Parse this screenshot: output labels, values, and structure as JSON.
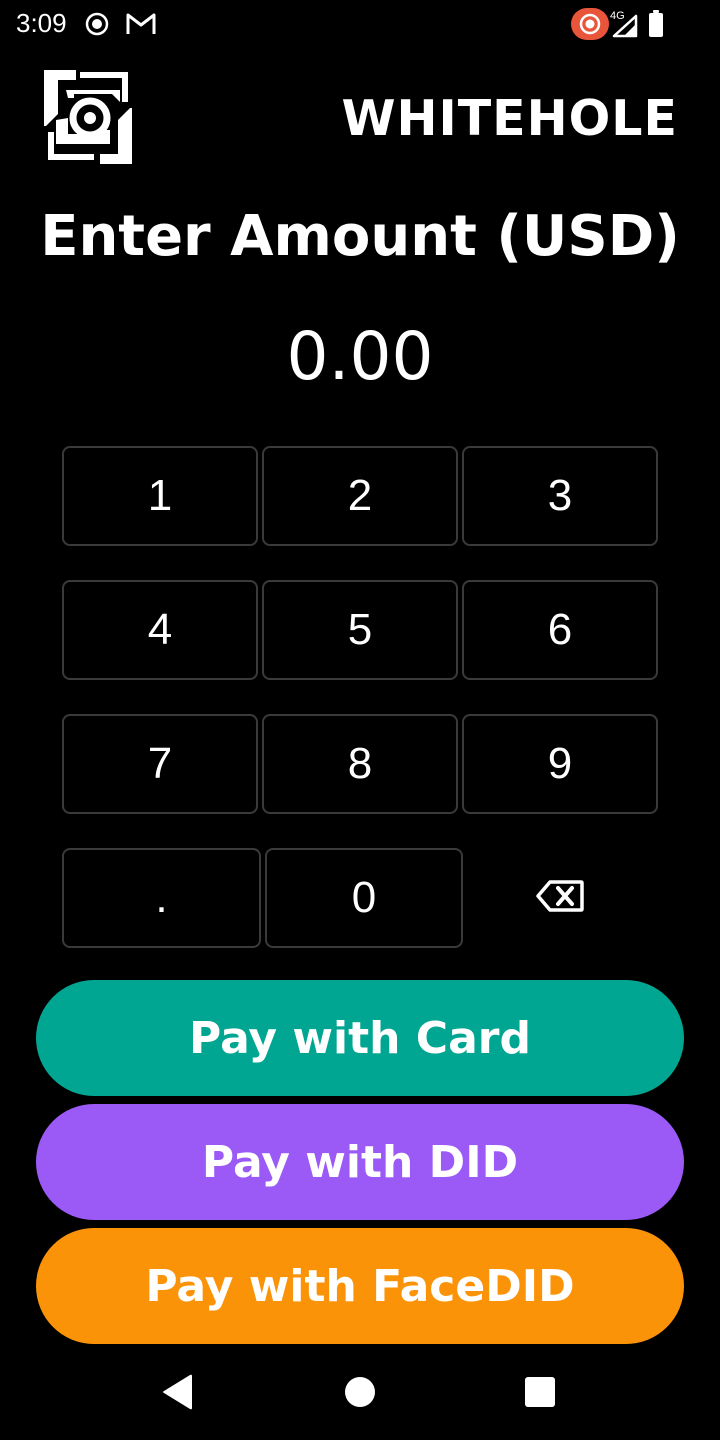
{
  "status_bar": {
    "time": "3:09",
    "network": "4G",
    "icons": [
      "hotspot-icon",
      "gmail-icon",
      "screen-record-icon",
      "signal-icon",
      "battery-icon"
    ]
  },
  "header": {
    "brand": "WHITEHOLE",
    "logo_icon": "whitehole-logo-icon"
  },
  "title": "Enter Amount (USD)",
  "amount": "0.00",
  "keypad": {
    "keys": [
      "1",
      "2",
      "3",
      "4",
      "5",
      "6",
      "7",
      "8",
      "9",
      ".",
      "0"
    ],
    "backspace_icon": "backspace-icon"
  },
  "actions": {
    "card": {
      "label": "Pay with Card",
      "color": "#00a691"
    },
    "did": {
      "label": "Pay with DID",
      "color": "#9b59f6"
    },
    "facedid": {
      "label": "Pay with FaceDID",
      "color": "#fb9308"
    }
  },
  "nav": {
    "icons": [
      "back-icon",
      "home-icon",
      "recents-icon"
    ]
  }
}
